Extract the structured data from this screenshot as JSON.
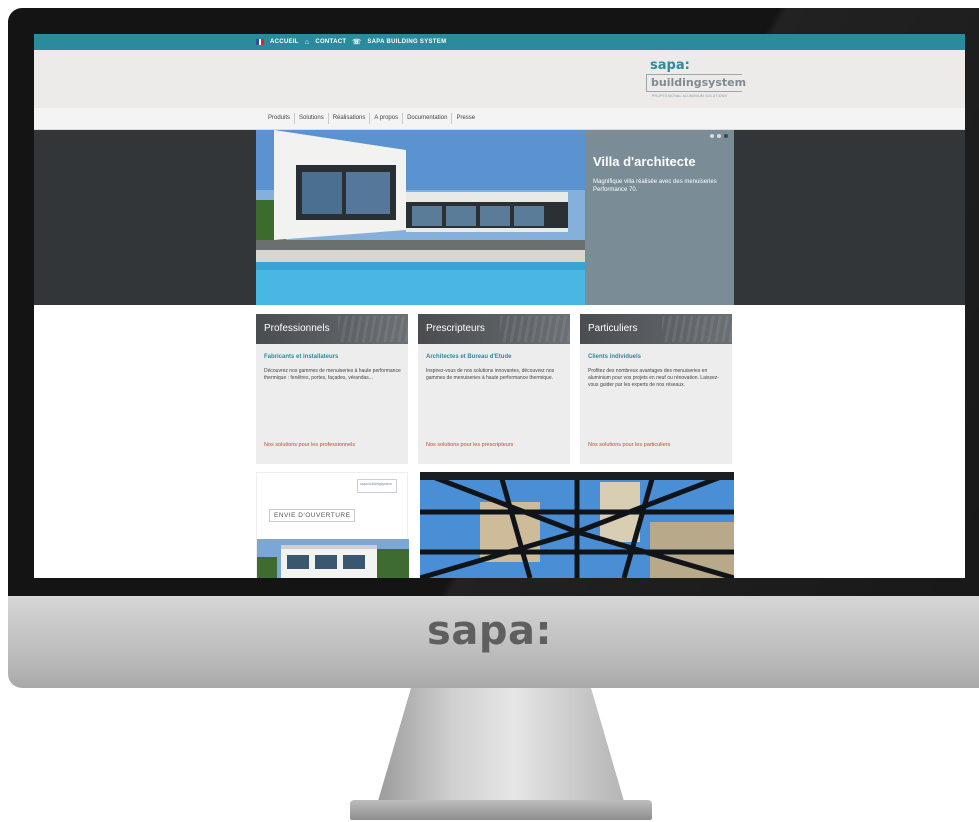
{
  "chin_logo": "sapa:",
  "topbar": {
    "home": "ACCUEIL",
    "contact": "CONTACT",
    "site": "SAPA BUILDING SYSTEM"
  },
  "logo": {
    "brand": "sapa:",
    "product": "buildingsystem",
    "tagline": "PROFESSIONAL ALUMINIUM SOLUTIONS"
  },
  "nav": [
    "Produits",
    "Solutions",
    "Réalisations",
    "A propos",
    "Documentation",
    "Presse"
  ],
  "hero": {
    "title": "Villa d'architecte",
    "description": "Magnifique villa réalisée avec des menuiseries Performance 70."
  },
  "cards": [
    {
      "title": "Professionnels",
      "subtitle": "Fabricants et installateurs",
      "text": "Découvrez nos gammes de menuiseries à haute performance thermique : fenêtres, portes, façades, vérandas...",
      "link": "Nos solutions pour les professionnels"
    },
    {
      "title": "Prescripteurs",
      "subtitle": "Architectes et Bureau d'Etude",
      "text": "Inspirez-vous de nos solutions innovantes, découvrez nos gammes de menuiseries à haute performance thermique.",
      "link": "Nos solutions pour les prescripteurs"
    },
    {
      "title": "Particuliers",
      "subtitle": "Clients individuels",
      "text": "Profitez des nombreux avantages des menuiseries en aluminium pour vos projets en neuf ou rénovation. Laissez-vous guider par les experts de nos réseaux.",
      "link": "Nos solutions pour les particuliers"
    }
  ],
  "promo": {
    "mini_logo": "sapa buildingsystem",
    "title": "ENVIE D'OUVERTURE"
  },
  "colors": {
    "accent": "#2b8a9e",
    "link": "#d2462c",
    "hero_panel": "#7a8c96",
    "dark_band": "#323638"
  }
}
